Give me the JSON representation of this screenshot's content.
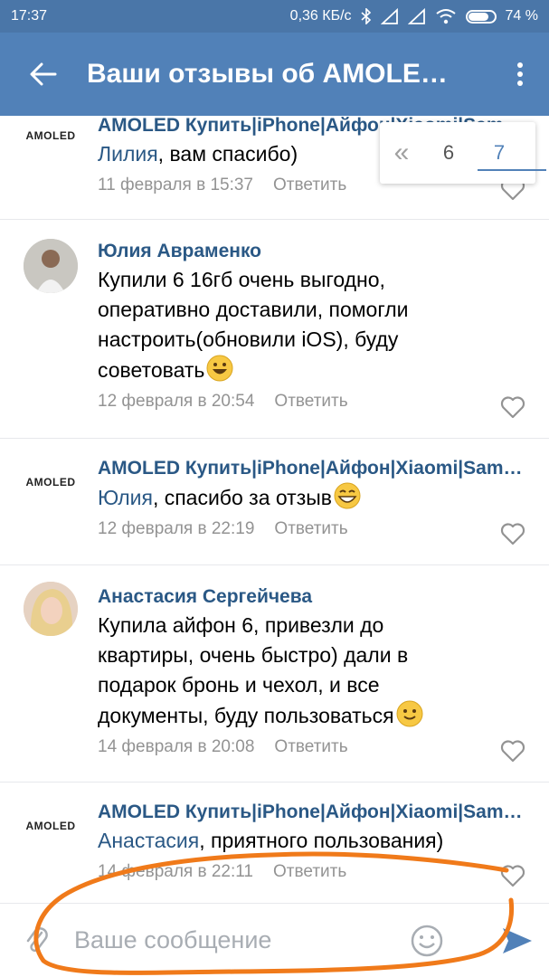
{
  "status_bar": {
    "time": "17:37",
    "network_speed": "0,36 КБ/с",
    "battery_percent": "74 %",
    "battery_level": 0.74
  },
  "app_bar": {
    "title": "Ваши отзывы об AMOLED Купить|iPhone|Айфон|Xiaomi|Samsung",
    "back_icon": "arrow-left-icon",
    "menu_icon": "more-vertical-icon"
  },
  "pager": {
    "prev_symbol": "«",
    "pages": [
      "6",
      "7"
    ],
    "current": "7"
  },
  "logo_text": "AMOLED",
  "comments": [
    {
      "author": "AMOLED Купить|iPhone|Айфон|Xiaomi|Samsung",
      "mention": "Лилия",
      "text": ", вам спасибо)",
      "date": "11 февраля в 15:37",
      "reply": "Ответить"
    },
    {
      "author": "Юлия Авраменко",
      "text": "Купили 6 16гб очень выгодно, оперативно доставили, помогли настроить(обновили iOS), буду советовать",
      "date": "12 февраля в 20:54",
      "reply": "Ответить"
    },
    {
      "author": "AMOLED Купить|iPhone|Айфон|Xiaomi|Samsung",
      "mention": "Юлия",
      "text": ", спасибо за отзыв",
      "date": "12 февраля в 22:19",
      "reply": "Ответить"
    },
    {
      "author": "Анастасия Сергейчева",
      "text": "Купила айфон 6, привезли до квартиры, очень быстро) дали в подарок бронь и чехол, и все документы, буду пользоваться",
      "date": "14 февраля в 20:08",
      "reply": "Ответить"
    },
    {
      "author": "AMOLED Купить|iPhone|Айфон|Xiaomi|Samsung",
      "mention": "Анастасия",
      "text": ", приятного пользования)",
      "date": "14 февраля в 22:11",
      "reply": "Ответить"
    }
  ],
  "composer": {
    "placeholder": "Ваше сообщение"
  },
  "colors": {
    "status_bar": "#4a76a8",
    "app_bar": "#5181b8",
    "link": "#2a5885",
    "meta": "#939393",
    "annotation_stroke": "#f07a1a"
  }
}
